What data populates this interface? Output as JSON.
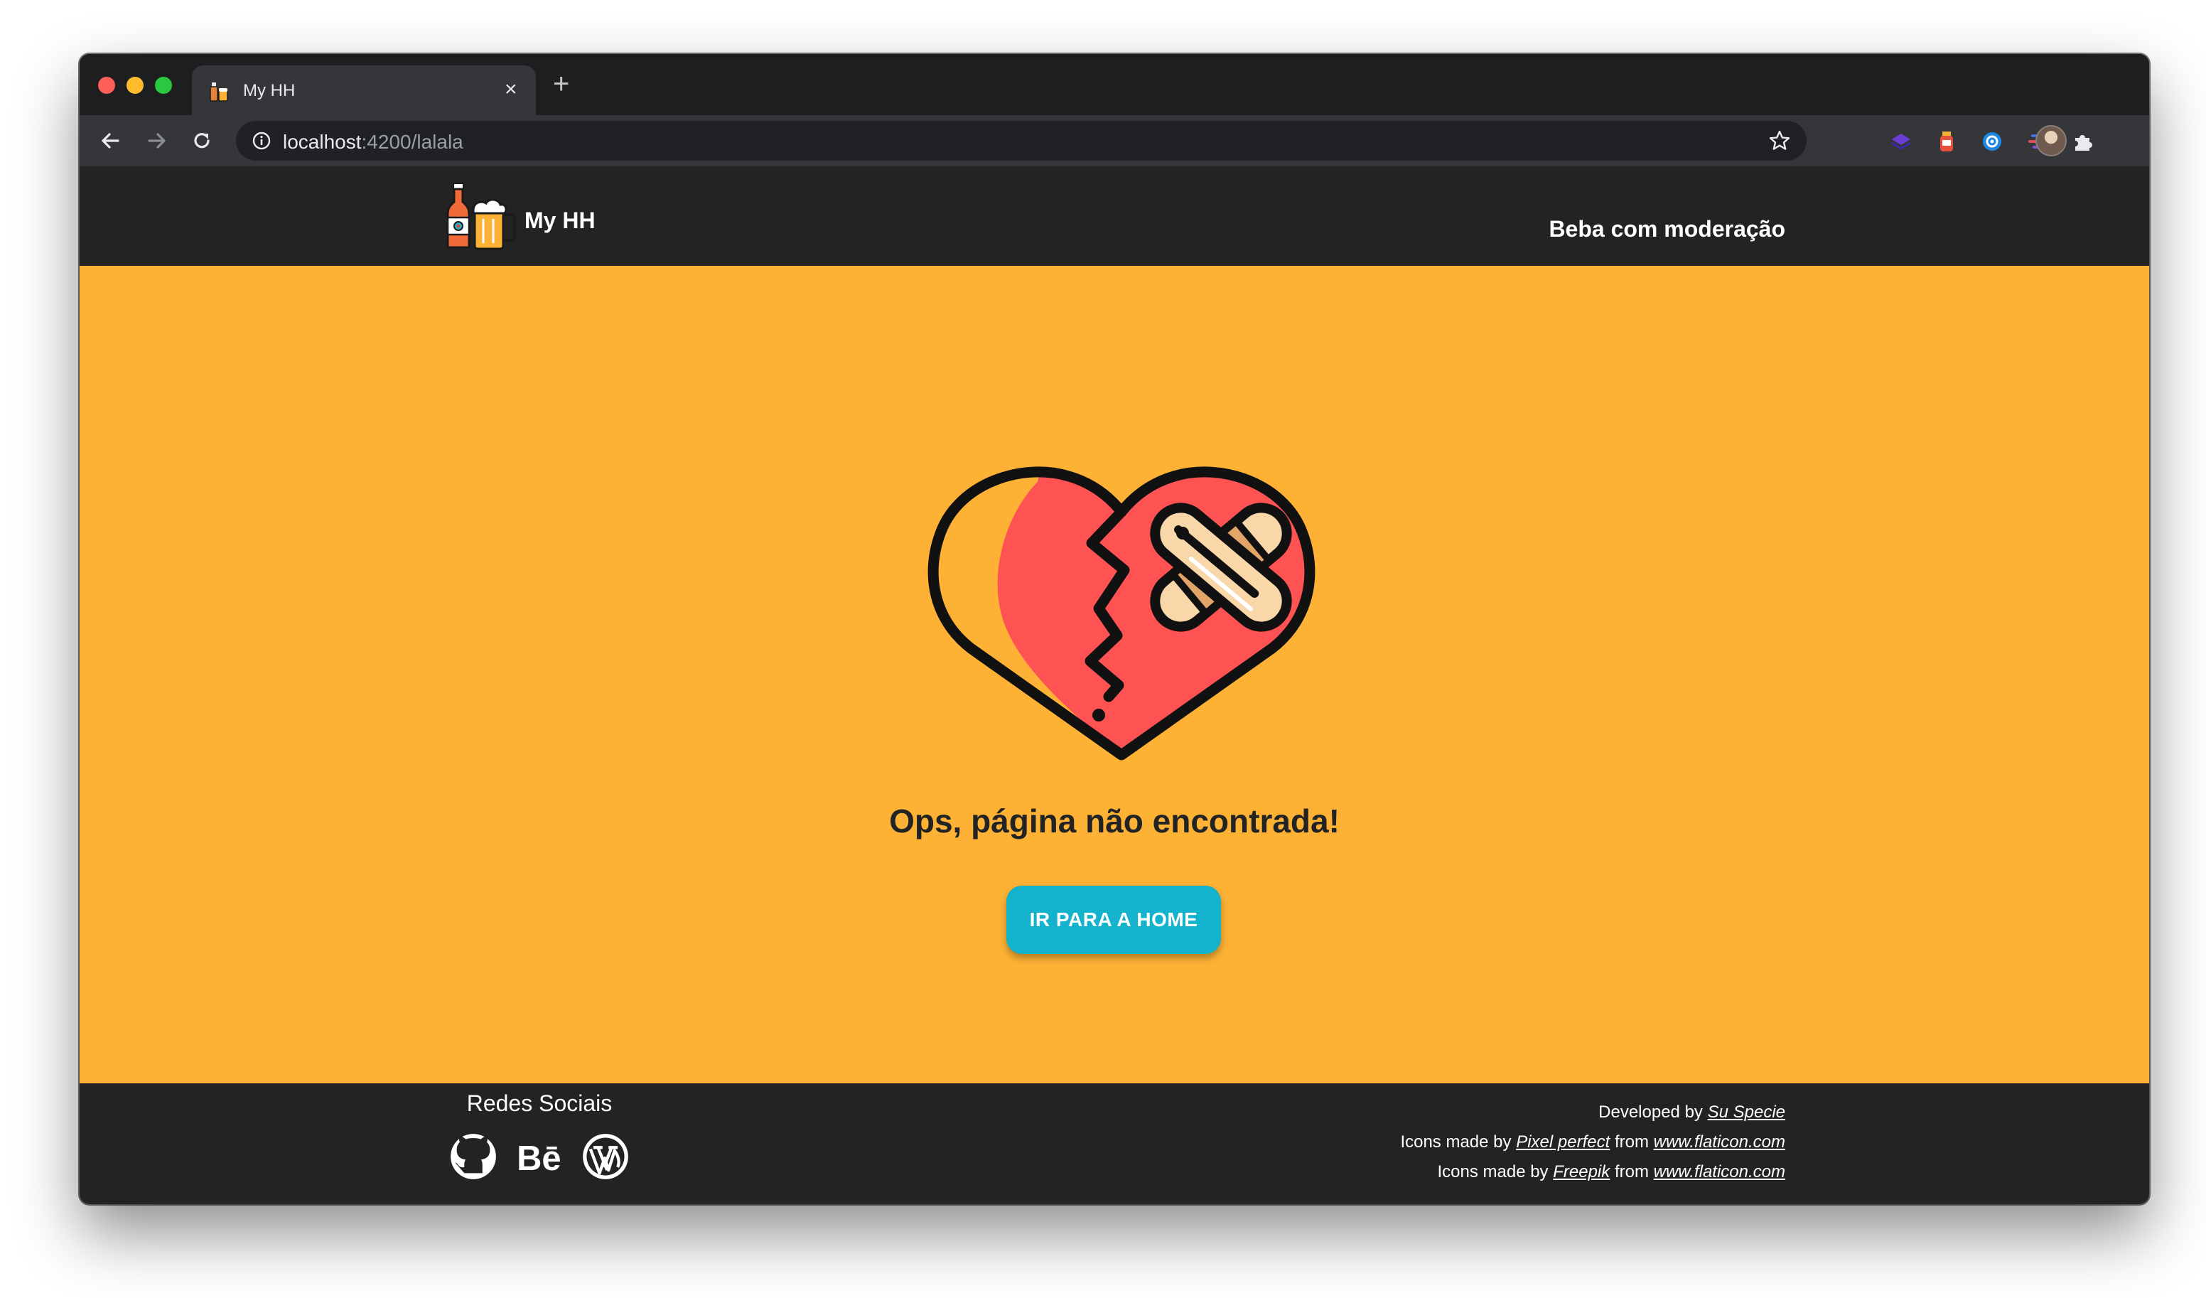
{
  "browser": {
    "tab_title": "My HH",
    "url_host": "localhost",
    "url_rest": ":4200/lalala",
    "tab_close": "×",
    "new_tab": "+"
  },
  "header": {
    "brand_name": "My HH",
    "motto": "Beba com moderação"
  },
  "main": {
    "headline": "Ops, página não encontrada!",
    "home_button_label": "IR PARA A HOME"
  },
  "footer": {
    "social_title": "Redes Sociais",
    "social_icons": [
      "github-icon",
      "behance-icon",
      "wordpress-icon"
    ],
    "credits": {
      "developed_by_prefix": "Developed by",
      "developer_name": "Su Specie",
      "line2_prefix": "Icons made by",
      "line2_author": "Pixel perfect",
      "line2_from": "from",
      "line2_site": "www.flaticon.com",
      "line3_prefix": "Icons made by",
      "line3_author": "Freepik",
      "line3_from": "from",
      "line3_site": "www.flaticon.com"
    }
  },
  "colors": {
    "page_background": "#fdb235",
    "header_footer_background": "#232323",
    "button_background": "#13b3cd",
    "heart_red": "#ff5252",
    "bandage": "#f9d7a8"
  }
}
